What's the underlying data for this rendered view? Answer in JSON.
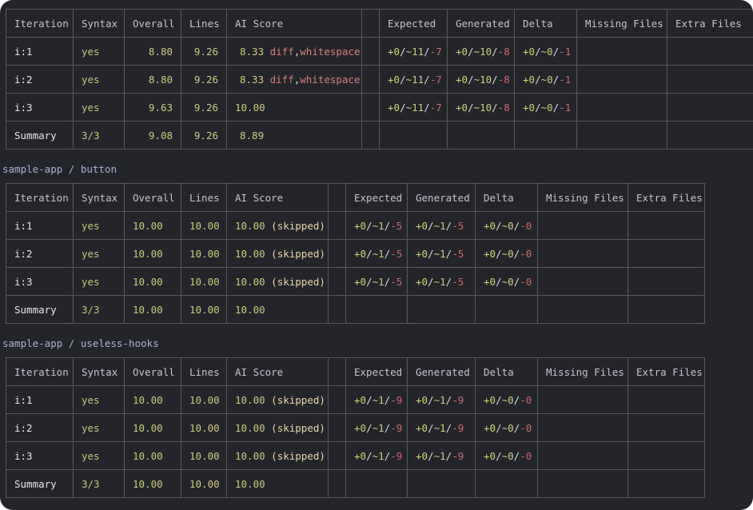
{
  "tables": [
    {
      "title": "",
      "headers": [
        "Iteration",
        "Syntax",
        "Overall",
        "Lines",
        "AI Score",
        "",
        "Expected",
        "Generated",
        "Delta",
        "Missing Files",
        "Extra Files"
      ],
      "rows": [
        {
          "iteration": "i:1",
          "syntax": "yes",
          "overall": "8.80",
          "lines": "9.26",
          "ai": "8.33",
          "note_a": "diff",
          "note_sep": ",",
          "note_b": "whitespace",
          "expected": {
            "a": "+0",
            "b": "~11",
            "c": "-7"
          },
          "generated": {
            "a": "+0",
            "b": "~10",
            "c": "-8"
          },
          "delta": {
            "a": "+0",
            "b": "~0",
            "c": "-1"
          }
        },
        {
          "iteration": "i:2",
          "syntax": "yes",
          "overall": "8.80",
          "lines": "9.26",
          "ai": "8.33",
          "note_a": "diff",
          "note_sep": ",",
          "note_b": "whitespace",
          "expected": {
            "a": "+0",
            "b": "~11",
            "c": "-7"
          },
          "generated": {
            "a": "+0",
            "b": "~10",
            "c": "-8"
          },
          "delta": {
            "a": "+0",
            "b": "~0",
            "c": "-1"
          }
        },
        {
          "iteration": "i:3",
          "syntax": "yes",
          "overall": "9.63",
          "lines": "9.26",
          "ai": "10.00",
          "note_a": "",
          "note_sep": "",
          "note_b": "",
          "expected": {
            "a": "+0",
            "b": "~11",
            "c": "-7"
          },
          "generated": {
            "a": "+0",
            "b": "~10",
            "c": "-8"
          },
          "delta": {
            "a": "+0",
            "b": "~0",
            "c": "-1"
          }
        }
      ],
      "summary": {
        "label": "Summary",
        "syntax": "3/3",
        "overall": "9.08",
        "lines": "9.26",
        "ai": "8.89"
      }
    },
    {
      "title": "sample-app / button",
      "headers": [
        "Iteration",
        "Syntax",
        "Overall",
        "Lines",
        "AI Score",
        "",
        "Expected",
        "Generated",
        "Delta",
        "Missing Files",
        "Extra Files"
      ],
      "rows": [
        {
          "iteration": "i:1",
          "syntax": "yes",
          "overall": "10.00",
          "lines": "10.00",
          "ai": "10.00",
          "skipped": "(skipped)",
          "expected": {
            "a": "+0",
            "b": "~1",
            "c": "-5"
          },
          "generated": {
            "a": "+0",
            "b": "~1",
            "c": "-5"
          },
          "delta": {
            "a": "+0",
            "b": "~0",
            "c": "-0"
          }
        },
        {
          "iteration": "i:2",
          "syntax": "yes",
          "overall": "10.00",
          "lines": "10.00",
          "ai": "10.00",
          "skipped": "(skipped)",
          "expected": {
            "a": "+0",
            "b": "~1",
            "c": "-5"
          },
          "generated": {
            "a": "+0",
            "b": "~1",
            "c": "-5"
          },
          "delta": {
            "a": "+0",
            "b": "~0",
            "c": "-0"
          }
        },
        {
          "iteration": "i:3",
          "syntax": "yes",
          "overall": "10.00",
          "lines": "10.00",
          "ai": "10.00",
          "skipped": "(skipped)",
          "expected": {
            "a": "+0",
            "b": "~1",
            "c": "-5"
          },
          "generated": {
            "a": "+0",
            "b": "~1",
            "c": "-5"
          },
          "delta": {
            "a": "+0",
            "b": "~0",
            "c": "-0"
          }
        }
      ],
      "summary": {
        "label": "Summary",
        "syntax": "3/3",
        "overall": "10.00",
        "lines": "10.00",
        "ai": "10.00"
      }
    },
    {
      "title": "sample-app / useless-hooks",
      "headers": [
        "Iteration",
        "Syntax",
        "Overall",
        "Lines",
        "AI Score",
        "",
        "Expected",
        "Generated",
        "Delta",
        "Missing Files",
        "Extra Files"
      ],
      "rows": [
        {
          "iteration": "i:1",
          "syntax": "yes",
          "overall": "10.00",
          "lines": "10.00",
          "ai": "10.00",
          "skipped": "(skipped)",
          "expected": {
            "a": "+0",
            "b": "~1",
            "c": "-9"
          },
          "generated": {
            "a": "+0",
            "b": "~1",
            "c": "-9"
          },
          "delta": {
            "a": "+0",
            "b": "~0",
            "c": "-0"
          }
        },
        {
          "iteration": "i:2",
          "syntax": "yes",
          "overall": "10.00",
          "lines": "10.00",
          "ai": "10.00",
          "skipped": "(skipped)",
          "expected": {
            "a": "+0",
            "b": "~1",
            "c": "-9"
          },
          "generated": {
            "a": "+0",
            "b": "~1",
            "c": "-9"
          },
          "delta": {
            "a": "+0",
            "b": "~0",
            "c": "-0"
          }
        },
        {
          "iteration": "i:3",
          "syntax": "yes",
          "overall": "10.00",
          "lines": "10.00",
          "ai": "10.00",
          "skipped": "(skipped)",
          "expected": {
            "a": "+0",
            "b": "~1",
            "c": "-9"
          },
          "generated": {
            "a": "+0",
            "b": "~1",
            "c": "-9"
          },
          "delta": {
            "a": "+0",
            "b": "~0",
            "c": "-0"
          }
        }
      ],
      "summary": {
        "label": "Summary",
        "syntax": "3/3",
        "overall": "10.00",
        "lines": "10.00",
        "ai": "10.00"
      }
    }
  ],
  "colors": {
    "background": "#23252b",
    "border": "#575a61",
    "yellow": "#cfcb7e",
    "green": "#c5d96d",
    "red": "#cc6a6a",
    "title": "#a9b4d6"
  }
}
